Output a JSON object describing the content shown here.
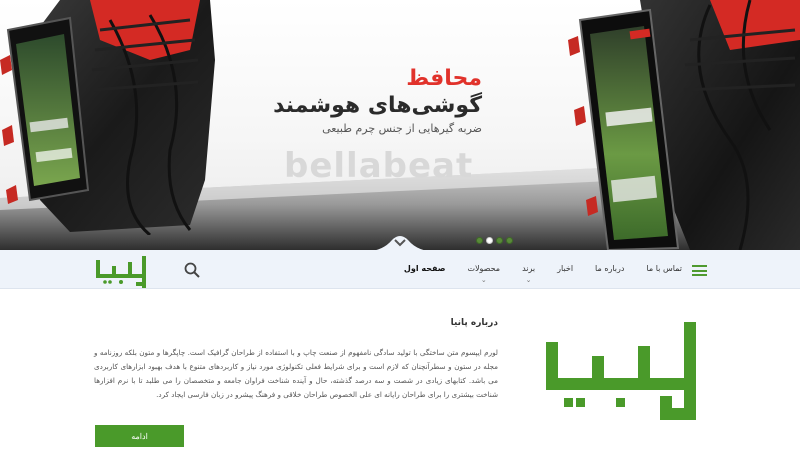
{
  "hero": {
    "tag_red": "محافظ",
    "tag_big": "گوشی‌های هوشمند",
    "tag_small": "ضربه گیرهایی از جنس چرم طبیعی",
    "brand": "bellabeat",
    "slider_dots": 4,
    "active_dot": 1
  },
  "nav": {
    "logo_text": "پانیا",
    "items": [
      {
        "label": "صفحه اول",
        "active": true,
        "has_dropdown": false
      },
      {
        "label": "محصولات",
        "active": false,
        "has_dropdown": true
      },
      {
        "label": "برند",
        "active": false,
        "has_dropdown": true
      },
      {
        "label": "اخبار",
        "active": false,
        "has_dropdown": false
      },
      {
        "label": "درباره ما",
        "active": false,
        "has_dropdown": false
      },
      {
        "label": "تماس با ما",
        "active": false,
        "has_dropdown": false
      }
    ]
  },
  "about": {
    "title": "درباره پانیا",
    "body": "لورم ایپسوم متن ساختگی با تولید سادگی نامفهوم از صنعت چاپ و با استفاده از طراحان گرافیک است. چاپگرها و متون بلکه روزنامه و مجله در ستون و سطرآنچنان که لازم است و برای شرایط فعلی تکنولوژی مورد نیاز و کاربردهای متنوع با هدف بهبود ابزارهای کاربردی می باشد. کتابهای زیادی در شصت و سه درصد گذشته، حال و آینده شناخت فراوان جامعه و متخصصان را می طلبد تا با نرم افزارها شناخت بیشتری را برای طراحان رایانه ای علی الخصوص طراحان خلاقی و فرهنگ پیشرو در زبان فارسی ایجاد کرد.",
    "button_label": "ادامه",
    "logo_text": "پانیا"
  },
  "colors": {
    "brand_green": "#4a9a2a",
    "accent_red": "#e1322b",
    "nav_bg": "#eef3fa"
  },
  "icons": {
    "search": "search-icon",
    "menu": "hamburger-menu-icon",
    "scroll": "chevron-down-icon"
  }
}
